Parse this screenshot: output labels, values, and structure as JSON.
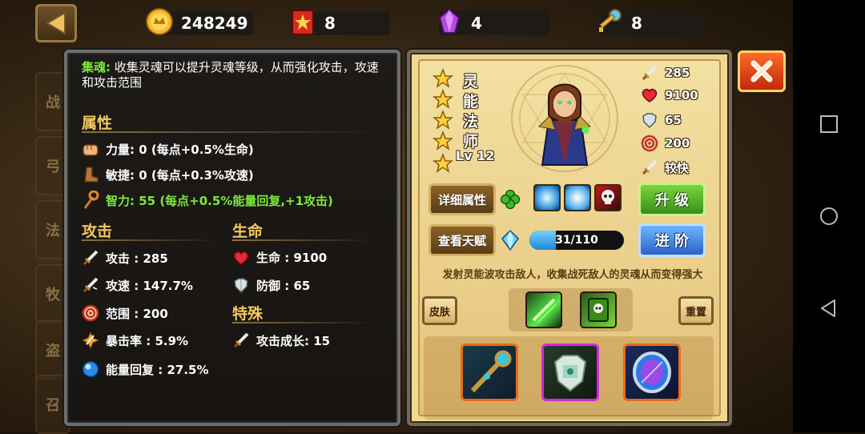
{
  "resources": {
    "gold": "248249",
    "red_item": "8",
    "gem": "4",
    "key": "8"
  },
  "left": {
    "desc_highlight": "集魂:",
    "desc_text": " 收集灵魂可以提升灵魂等级，从而强化攻击，攻速和攻击范围",
    "attr_title": "属性",
    "strength": "力量: 0 (每点+0.5%生命)",
    "agility": "敏捷:  0 (每点+0.3%攻速)",
    "intellect": "智力: 55 (每点+0.5%能量回复,+1攻击)",
    "attack_title": "攻击",
    "life_title": "生命",
    "special_title": "特殊",
    "atk": "攻击 : 285",
    "atk_speed": "攻速 : 147.7%",
    "range": "范围 : 200",
    "crit": "暴击率 : 5.9%",
    "energy": "能量回复 : 27.5%",
    "hp": "生命 : 9100",
    "defense": "防御 : 65",
    "atk_growth": "攻击成长: 15"
  },
  "hero": {
    "name_chars": [
      "灵",
      "能",
      "法",
      "师"
    ],
    "level": "Lv 12",
    "atk": "285",
    "hp": "9100",
    "def": "65",
    "range": "200",
    "speed": "较快"
  },
  "buttons": {
    "detail": "详细属性",
    "talent": "查看天赋",
    "upgrade": "升 级",
    "advance": "进 阶",
    "skin": "皮肤",
    "reset": "重置"
  },
  "xp": {
    "text": "31/110",
    "progress": 0.28
  },
  "skill_desc": "发射灵能波攻击敌人，收集战死敌人的灵魂从而变得强大",
  "bg_tabs": [
    "战",
    "弓",
    "法",
    "牧",
    "盗",
    "召"
  ]
}
